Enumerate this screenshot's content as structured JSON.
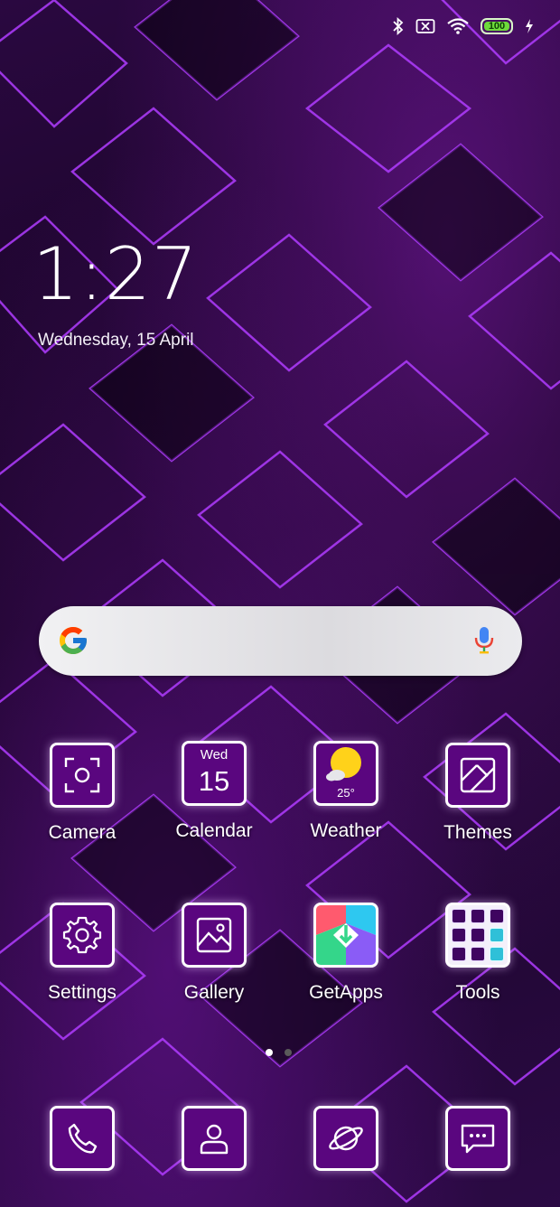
{
  "status_bar": {
    "icons": [
      "bluetooth-icon",
      "no-sim-icon",
      "wifi-icon",
      "battery-icon",
      "charging-icon"
    ],
    "battery_level": "100"
  },
  "clock": {
    "time": "1:27",
    "date": "Wednesday, 15 April"
  },
  "search": {
    "logo": "google-g-icon",
    "mic": "mic-icon"
  },
  "apps": [
    {
      "label": "Camera",
      "icon": "camera-icon"
    },
    {
      "label": "Calendar",
      "icon": "calendar-icon",
      "day": "Wed",
      "date": "15"
    },
    {
      "label": "Weather",
      "icon": "weather-icon",
      "temp": "25°"
    },
    {
      "label": "Themes",
      "icon": "themes-icon"
    },
    {
      "label": "Settings",
      "icon": "gear-icon"
    },
    {
      "label": "Gallery",
      "icon": "gallery-icon"
    },
    {
      "label": "GetApps",
      "icon": "getapps-icon"
    },
    {
      "label": "Tools",
      "icon": "tools-folder-icon"
    }
  ],
  "page_indicator": {
    "pages": 2,
    "current": 1
  },
  "dock": [
    {
      "icon": "phone-icon"
    },
    {
      "icon": "contacts-icon"
    },
    {
      "icon": "browser-icon"
    },
    {
      "icon": "messages-icon"
    }
  ],
  "colors": {
    "tile_bg": "#5a067f",
    "tile_border": "#ffffff",
    "accent_purple": "#8a1fd0"
  }
}
